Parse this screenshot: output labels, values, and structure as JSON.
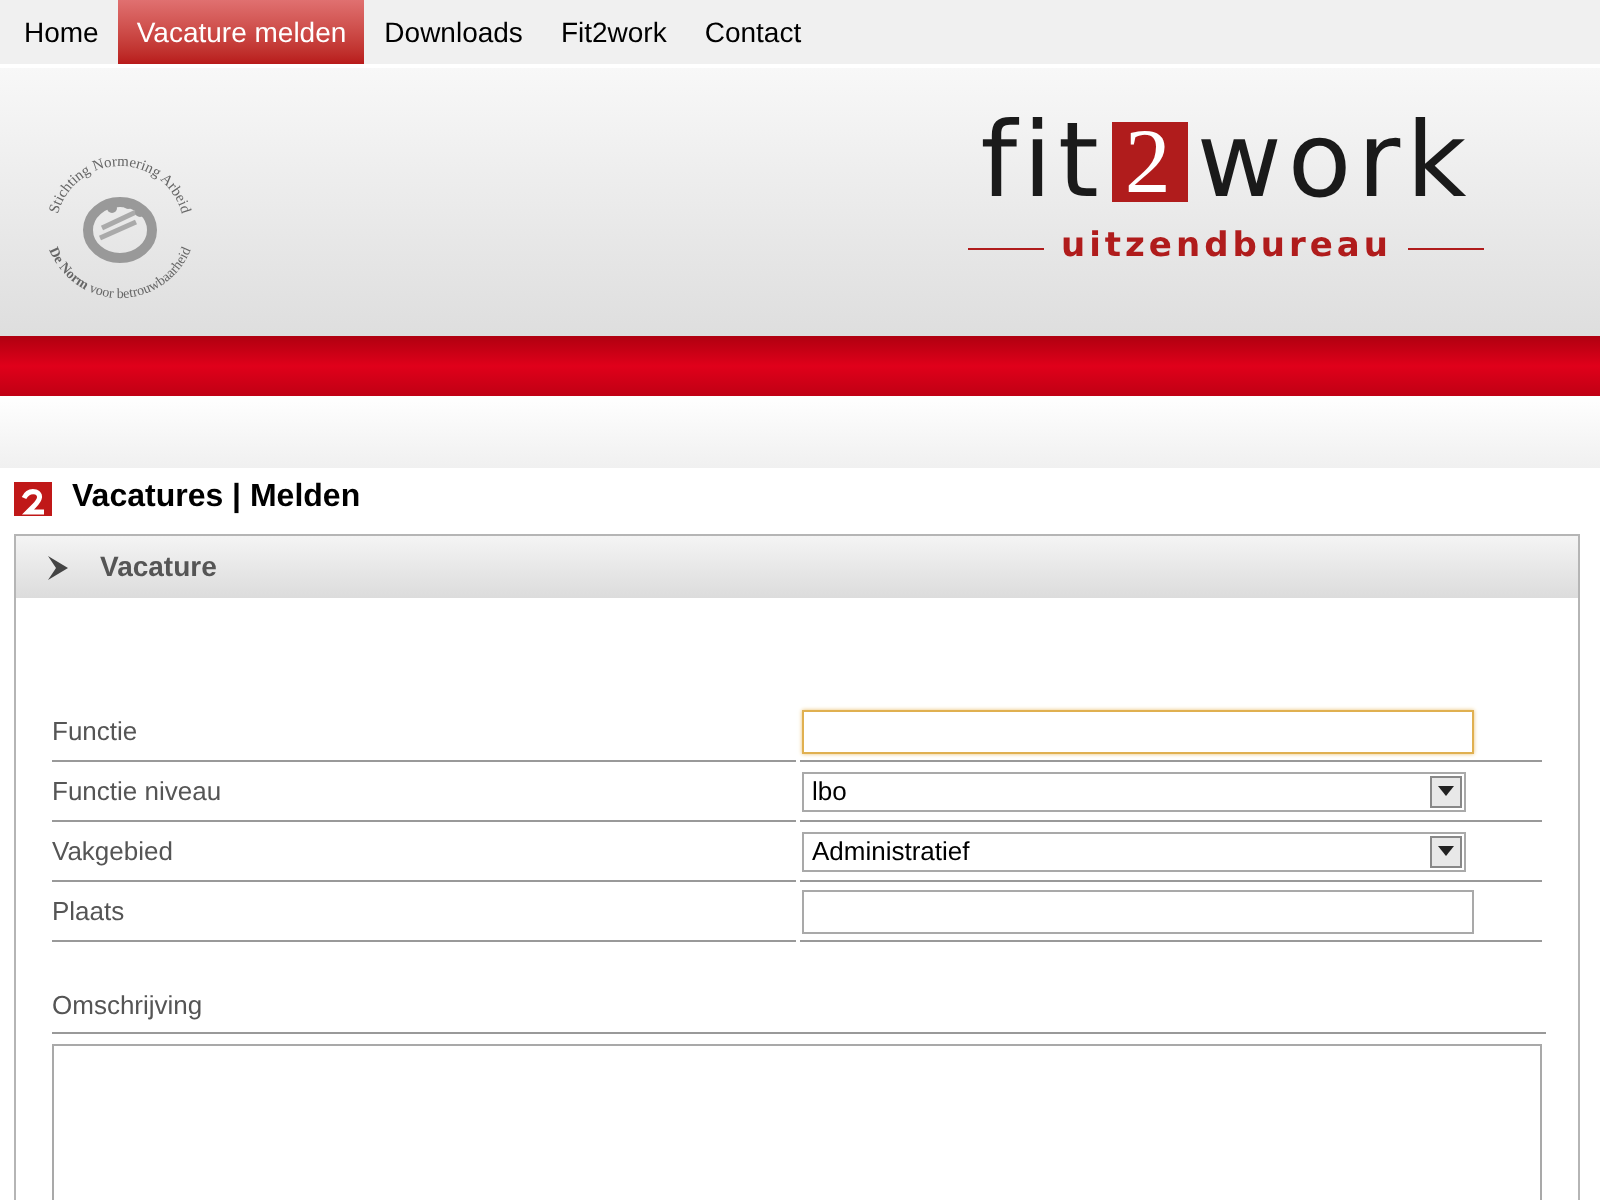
{
  "nav": [
    {
      "label": "Home",
      "selected": false
    },
    {
      "label": "Vacature melden",
      "selected": true
    },
    {
      "label": "Downloads",
      "selected": false
    },
    {
      "label": "Fit2work",
      "selected": false
    },
    {
      "label": "Contact",
      "selected": false
    }
  ],
  "seal": {
    "top_text": "Stichting Normering Arbeid",
    "bottom_bold": "De Norm",
    "bottom_text": "voor betrouwbaarheid"
  },
  "brand": {
    "left": "fit",
    "mark": "2",
    "right": "work",
    "tagline": "uitzendbureau"
  },
  "page_title": "Vacatures | Melden",
  "panel": {
    "title": "Vacature"
  },
  "fields": [
    {
      "label": "Functie",
      "kind": "text",
      "focused": true
    },
    {
      "label": "Functie niveau",
      "kind": "select",
      "value": "lbo"
    },
    {
      "label": "Vakgebied",
      "kind": "select",
      "value": "Administratief"
    },
    {
      "label": "Plaats",
      "kind": "text",
      "focused": false
    }
  ],
  "description": {
    "label": "Omschrijving"
  }
}
